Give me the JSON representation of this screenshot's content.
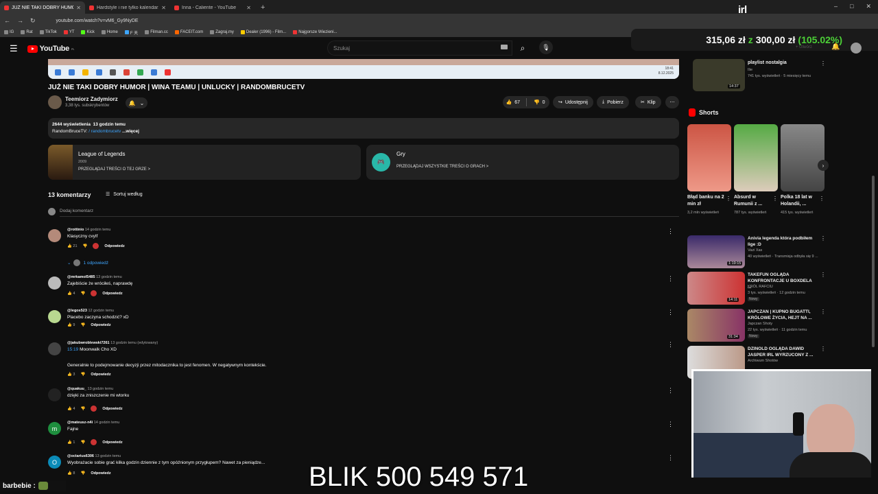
{
  "browser": {
    "tabs": [
      {
        "label": "JUŻ NIE TAKI DOBRY HUMOR",
        "active": true
      },
      {
        "label": "Hardstyle i nie tylko kalendarz adwe",
        "active": false
      },
      {
        "label": "Inna - Caliente - YouTube",
        "active": false
      }
    ],
    "new_tab": "+",
    "window_controls": [
      "–",
      "□",
      "✕"
    ],
    "url": "youtube.com/watch?v=vM6_Gy9NyDE",
    "bookmarks": [
      "IG",
      "Rat",
      "TikTok",
      "YT",
      "Kick",
      "Home",
      "F 天",
      "Filman.cc",
      "FACEIT.com",
      "Zagraj.my",
      "Dealer (1996) - Film...",
      "Najgorsze Wiezieni..."
    ]
  },
  "overlay": {
    "irl_logo": "irl",
    "donation_current": "315,06 zł",
    "donation_z": "z",
    "donation_goal": "300,00 zł",
    "donation_pct": "(105.02%)",
    "blik": "BLIK 500 549 571",
    "chat_user": "barbebie :"
  },
  "youtube": {
    "logo": "YouTube",
    "logo_region": "PL",
    "search_placeholder": "Szukaj",
    "create_label": "+ Utwórz"
  },
  "video": {
    "title": "JUŻ NIE TAKI DOBRY HUMOR | WINA TEAMU | UNLUCKY | RANDOMBRUCETV",
    "channel": "Teemiorz Zadymiorz",
    "subscribers": "3,38 tys. subskrybentów",
    "likes": "67",
    "dislikes": "0",
    "share": "Udostępnij",
    "download": "Pobierz",
    "clip": "Klip",
    "views": "2644 wyświetlenia",
    "age": "13 godzin temu",
    "desc_prefix": "RandomBruceTV:",
    "desc_link": "/ randombrucetv",
    "desc_more": "...więcej",
    "tray_time": "18:41",
    "tray_date": "8.12.2025"
  },
  "categories": [
    {
      "title": "League of Legends",
      "year": "2009",
      "browse": "PRZEGLĄDAJ TREŚCI O TEJ GRZE  >"
    },
    {
      "title": "Gry",
      "year": "",
      "browse": "PRZEGLĄDAJ WSZYSTKIE TREŚCI O GRACH  >"
    }
  ],
  "comments_section": {
    "count": "13 komentarzy",
    "sort": "Sortuj według",
    "add": "Dodaj komentarz",
    "reply_label": "Odpowiedz",
    "replies_link": "1 odpowiedź"
  },
  "comments": [
    {
      "author": "@rottinio",
      "time": "14 godzin temu",
      "text": "Klasyczny cvyIf",
      "likes": "21",
      "hearted": true
    },
    {
      "author": "@mrkamol5485",
      "time": "13 godzin temu",
      "text": "Zajebiście że wróciłeś, naprawdę",
      "likes": "4",
      "hearted": true
    },
    {
      "author": "@legos523",
      "time": "12 godzin temu",
      "text": "Placebo zaczyna schodzić? xD",
      "likes": "9",
      "hearted": false
    },
    {
      "author": "@jakubwroblewski7261",
      "time": "13 godzin temu (edytowany)",
      "timestamp": "15:19",
      "text": "Moonwalk Cho XD",
      "text2": "Generalnie to podejmowanie decyzji przez mitodacznika to jest fenomen. W negatywnym kontekście.",
      "likes": "3",
      "hearted": false
    },
    {
      "author": "@quakuu_",
      "time": "13 godzin temu",
      "text": "dzięki za zniszczenie mi wtorku",
      "likes": "4",
      "hearted": true
    },
    {
      "author": "@mateusz-n4i",
      "time": "14 godzin temu",
      "text": "Fajne",
      "likes": "1",
      "hearted": true
    },
    {
      "author": "@octarius6306",
      "time": "13 godzin temu",
      "text": "Wyobrażacie sobie grać kilka godzin dziennie z tym opóźnionym przygłupem? Nawet za pieniądze...",
      "likes": "8",
      "hearted": false
    }
  ],
  "sidebar": {
    "playlist": {
      "title": "playlist nostalgia",
      "channel": "Ilie",
      "meta": "741 tys. wyświetleń · 5 miesięcy temu",
      "duration": "14:37"
    },
    "shorts_title": "Shorts",
    "shorts": [
      {
        "title": "Błąd banku na 2 min zł",
        "views": "3,2 mln wyświetleń"
      },
      {
        "title": "Absurd w Rumunii z ...",
        "views": "787 tys. wyświetleń"
      },
      {
        "title": "Polka 18 lat w Holandii, ...",
        "views": "415 tys. wyświetleń"
      }
    ],
    "recommended": [
      {
        "title": "Anivia legenda która podbiłem lige :D",
        "channel": "Vazi Xas",
        "meta": "40 wyświetleń · Transmisja odbyła się 9 ...",
        "duration": "1:19:15",
        "badge": ""
      },
      {
        "title": "TAKEFUN OGLĄDA KONFRONTACJE U BOXDELA ...",
        "channel": "KRÓL RAFCIU",
        "meta": "3 tys. wyświetleń · 12 godzin temu",
        "duration": "14:11",
        "badge": "Nowy"
      },
      {
        "title": "JAPCZAN | KUPNO BUGATTI, KRÓLOWE ŻYCIA, HEJT NA ...",
        "channel": "Japczan Shoty",
        "meta": "22 tys. wyświetleń · 11 godzin temu",
        "duration": "31:34",
        "badge": "Nowy"
      },
      {
        "title": "DZINOLD OGLĄDA DAWID JASPER IRL WYRZUCONY Z ...",
        "channel": "Archiwum Shotów",
        "meta": "",
        "duration": "",
        "badge": ""
      }
    ]
  },
  "colors": {
    "accent_link": "#3ea6ff",
    "yt_red": "#ff0000",
    "donation_green": "#4cd137"
  }
}
